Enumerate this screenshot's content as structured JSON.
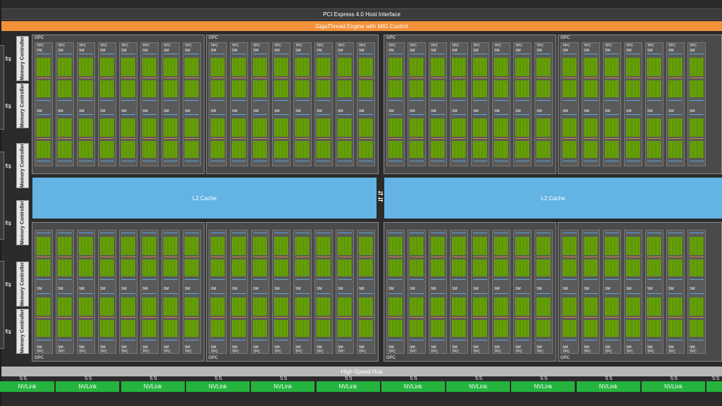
{
  "header": {
    "pcie_label": "PCI Express 4.0 Host Interface",
    "giga_label": "GigaThread Engine with MIG Control"
  },
  "memory": {
    "controller_label": "Memory Controller",
    "controllers": 6
  },
  "cache": {
    "l2_label": "L2 Cache"
  },
  "gpc": {
    "label": "GPC",
    "tpc_label": "TPC",
    "sm_label": "SM"
  },
  "hub": {
    "label": "High-Speed Hub"
  },
  "nvlink": {
    "label": "NVLink",
    "count": 11
  },
  "colors": {
    "pcie_bar": "#3b3b3b",
    "giga_bar": "#f2913a",
    "l2_cache": "#63b4e4",
    "hub_bar": "#b7b7b7",
    "nvlink": "#24b43e",
    "sm_cores": "#76b900"
  }
}
